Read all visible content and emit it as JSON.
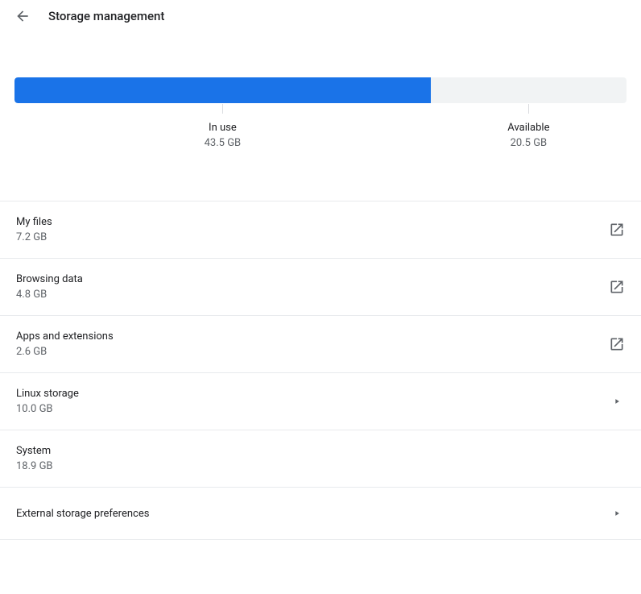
{
  "header": {
    "title": "Storage management"
  },
  "chart_data": {
    "type": "bar",
    "title": "",
    "series": [
      {
        "name": "In use",
        "value": 43.5,
        "unit": "GB",
        "display": "43.5 GB"
      },
      {
        "name": "Available",
        "value": 20.5,
        "unit": "GB",
        "display": "20.5 GB"
      }
    ],
    "total": 64.0,
    "used_percent": 68
  },
  "items": [
    {
      "title": "My files",
      "subtitle": "7.2 GB",
      "action": "external"
    },
    {
      "title": "Browsing data",
      "subtitle": "4.8 GB",
      "action": "external"
    },
    {
      "title": "Apps and extensions",
      "subtitle": "2.6 GB",
      "action": "external"
    },
    {
      "title": "Linux storage",
      "subtitle": "10.0 GB",
      "action": "arrow"
    },
    {
      "title": "System",
      "subtitle": "18.9 GB",
      "action": "none"
    },
    {
      "title": "External storage preferences",
      "subtitle": "",
      "action": "arrow"
    }
  ]
}
